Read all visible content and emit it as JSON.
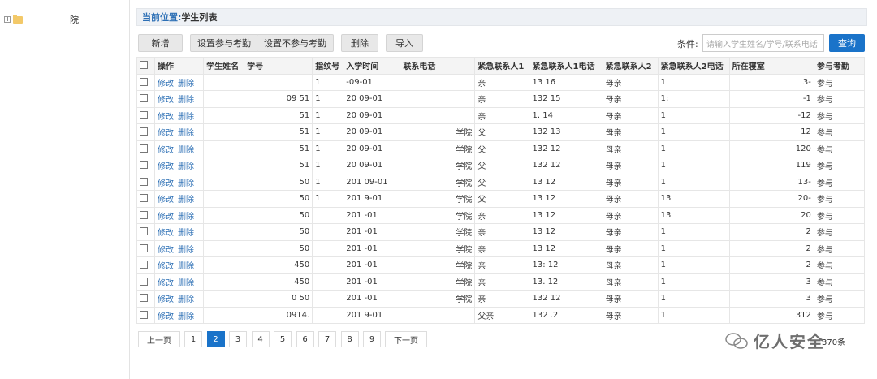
{
  "sidebar": {
    "toggle": "+",
    "tree_label": "院"
  },
  "breadcrumb": {
    "label": "当前位置:",
    "current": "学生列表"
  },
  "toolbar": {
    "add": "新增",
    "set_attend": "设置参与考勤",
    "set_not_attend": "设置不参与考勤",
    "delete": "删除",
    "import": "导入",
    "condition_label": "条件:",
    "search_placeholder": "请输入学生姓名/学号/联系电话",
    "search": "查询"
  },
  "table": {
    "headers": [
      "操作",
      "学生姓名",
      "学号",
      "指纹号",
      "入学时间",
      "联系电话",
      "紧急联系人1",
      "紧急联系人1电话",
      "紧急联系人2",
      "紧急联系人2电话",
      "所在寝室",
      "参与考勤"
    ],
    "edit_label": "修改",
    "delete_label": "删除",
    "rows": [
      {
        "sid": "",
        "fp": "1",
        "date": "-09-01",
        "phone": "",
        "c1": "亲",
        "c1p": "13   16",
        "c2": "母亲",
        "c2p": "1",
        "room": "3-",
        "att": "参与"
      },
      {
        "sid": "09   51",
        "fp": "1",
        "date": "20  09-01",
        "phone": "",
        "c1": "亲",
        "c1p": "132  15",
        "c2": "母亲",
        "c2p": "1:",
        "room": "-1",
        "att": "参与"
      },
      {
        "sid": "51",
        "fp": "1",
        "date": "20  09-01",
        "phone": "",
        "c1": "亲",
        "c1p": "1.  14",
        "c2": "母亲",
        "c2p": "1",
        "room": "-12",
        "att": "参与"
      },
      {
        "sid": "51",
        "fp": "1",
        "date": "20  09-01",
        "phone": "学院",
        "c1": "父",
        "c1p": "132  13",
        "c2": "母亲",
        "c2p": "1",
        "room": "12",
        "att": "参与"
      },
      {
        "sid": "51",
        "fp": "1",
        "date": "20  09-01",
        "phone": "学院",
        "c1": "父",
        "c1p": "132  12",
        "c2": "母亲",
        "c2p": "1",
        "room": "120",
        "att": "参与"
      },
      {
        "sid": "51",
        "fp": "1",
        "date": "20  09-01",
        "phone": "学院",
        "c1": "父",
        "c1p": "132  12",
        "c2": "母亲",
        "c2p": "1",
        "room": "119",
        "att": "参与"
      },
      {
        "sid": "50",
        "fp": "1",
        "date": "201  09-01",
        "phone": "学院",
        "c1": "父",
        "c1p": "13   12",
        "c2": "母亲",
        "c2p": "1",
        "room": "13-",
        "att": "参与"
      },
      {
        "sid": "50",
        "fp": "1",
        "date": "201  9-01",
        "phone": "学院",
        "c1": "父",
        "c1p": "13   12",
        "c2": "母亲",
        "c2p": "13",
        "room": "20-",
        "att": "参与"
      },
      {
        "sid": "50",
        "fp": "",
        "date": "201  -01",
        "phone": "学院",
        "c1": "亲",
        "c1p": "13   12",
        "c2": "母亲",
        "c2p": "13",
        "room": "20",
        "att": "参与"
      },
      {
        "sid": "50",
        "fp": "",
        "date": "201  -01",
        "phone": "学院",
        "c1": "亲",
        "c1p": "13   12",
        "c2": "母亲",
        "c2p": "1",
        "room": "2",
        "att": "参与"
      },
      {
        "sid": "50",
        "fp": "",
        "date": "201  -01",
        "phone": "学院",
        "c1": "亲",
        "c1p": "13   12",
        "c2": "母亲",
        "c2p": "1",
        "room": "2",
        "att": "参与"
      },
      {
        "sid": "450",
        "fp": "",
        "date": "201  -01",
        "phone": "学院",
        "c1": "亲",
        "c1p": "13:  12",
        "c2": "母亲",
        "c2p": "1",
        "room": "2",
        "att": "参与"
      },
      {
        "sid": "450",
        "fp": "",
        "date": "201  -01",
        "phone": "学院",
        "c1": "亲",
        "c1p": "13.  12",
        "c2": "母亲",
        "c2p": "1",
        "room": "3",
        "att": "参与"
      },
      {
        "sid": "0   50",
        "fp": "",
        "date": "201  -01",
        "phone": "学院",
        "c1": "亲",
        "c1p": "132  12",
        "c2": "母亲",
        "c2p": "1",
        "room": "3",
        "att": "参与"
      },
      {
        "sid": "0914.",
        "fp": "",
        "date": "201  9-01",
        "phone": "",
        "c1": "父亲",
        "c1p": "132  .2",
        "c2": "母亲",
        "c2p": "1",
        "room": "312",
        "att": "参与"
      }
    ]
  },
  "pager": {
    "prev": "上一页",
    "pages": [
      "1",
      "2",
      "3",
      "4",
      "5",
      "6",
      "7",
      "8",
      "9"
    ],
    "active_index": 1,
    "next": "下一页",
    "total": "370条"
  },
  "watermark": {
    "text": "亿人安全"
  },
  "colors": {
    "accent": "#1a73c9",
    "link": "#2c6fb5",
    "folder": "#f3c969"
  }
}
